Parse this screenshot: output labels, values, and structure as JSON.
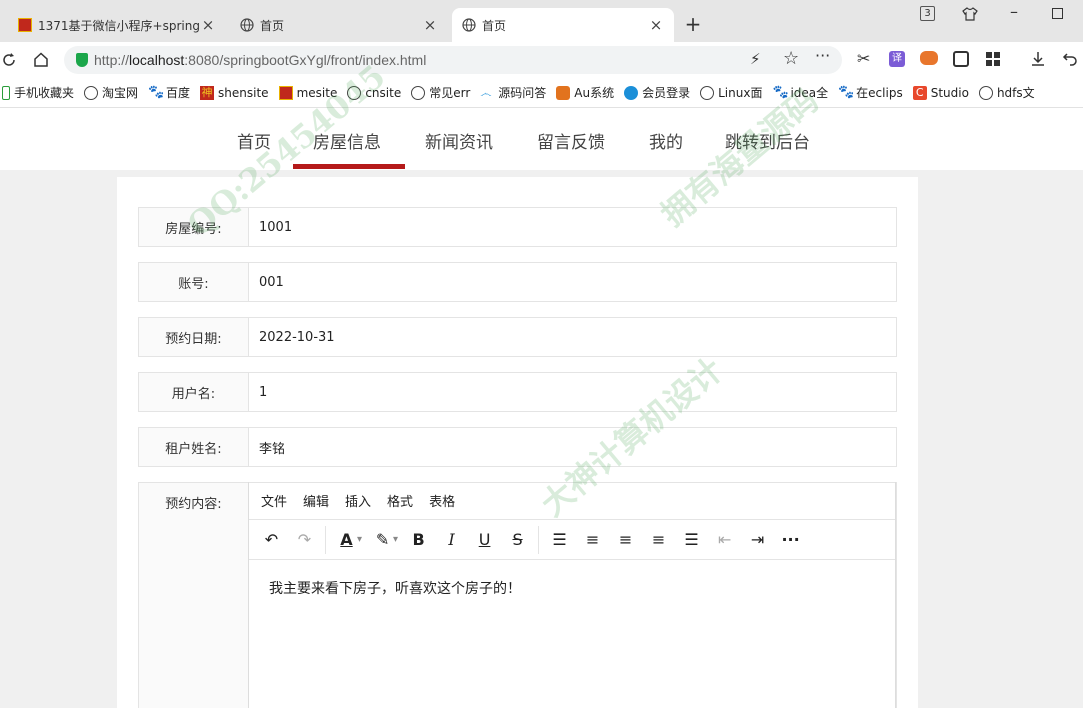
{
  "browser": {
    "tabs": [
      {
        "label": "1371基于微信小程序+spring"
      },
      {
        "label": "首页"
      },
      {
        "label": "首页"
      }
    ],
    "new_tab": "+",
    "window_badge": "3",
    "url_scheme": "http://",
    "url_host": "localhost",
    "url_path": ":8080/springbootGxYgl/front/index.html",
    "bookmarks": [
      {
        "label": "手机收藏夹"
      },
      {
        "label": "淘宝网"
      },
      {
        "label": "百度"
      },
      {
        "label": "shensite"
      },
      {
        "label": "mesite"
      },
      {
        "label": "cnsite"
      },
      {
        "label": "常见err"
      },
      {
        "label": "源码问答"
      },
      {
        "label": "Au系统"
      },
      {
        "label": "会员登录"
      },
      {
        "label": "Linux面"
      },
      {
        "label": "idea全"
      },
      {
        "label": "在eclips"
      },
      {
        "label": "Studio"
      },
      {
        "label": "hdfs文"
      }
    ]
  },
  "site_nav": {
    "items": [
      {
        "label": "首页"
      },
      {
        "label": "房屋信息"
      },
      {
        "label": "新闻资讯"
      },
      {
        "label": "留言反馈"
      },
      {
        "label": "我的"
      },
      {
        "label": "跳转到后台"
      }
    ],
    "active_index": 1,
    "accent_color": "#b51a1a"
  },
  "form": {
    "rows": [
      {
        "label": "房屋编号:",
        "value": "1001"
      },
      {
        "label": "账号:",
        "value": "001"
      },
      {
        "label": "预约日期:",
        "value": "2022-10-31"
      },
      {
        "label": "用户名:",
        "value": "1"
      },
      {
        "label": "租户姓名:",
        "value": "李铭"
      }
    ],
    "content_label": "预约内容:"
  },
  "editor": {
    "menu": [
      "文件",
      "编辑",
      "插入",
      "格式",
      "表格"
    ],
    "toolbar_icons": [
      "undo-icon",
      "redo-icon",
      "font-color-icon",
      "highlight-icon",
      "bold-icon",
      "italic-icon",
      "underline-icon",
      "strikethrough-icon",
      "line-height-icon",
      "align-left-icon",
      "align-center-icon",
      "align-right-icon",
      "justify-icon",
      "outdent-icon",
      "indent-icon",
      "more-icon"
    ],
    "body_text": "我主要来看下房子，听喜欢这个房子的！"
  },
  "watermark": {
    "lines": [
      "QQ:25454045",
      "大神计算机设计",
      "拥有海量源码"
    ]
  }
}
